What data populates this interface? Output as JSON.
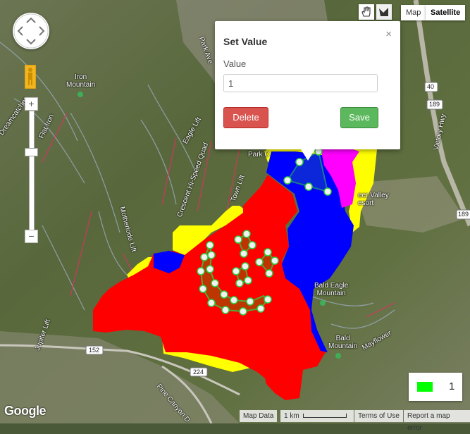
{
  "map": {
    "labels": {
      "iron_mountain": "Iron\nMountain",
      "park_ave": "Park Ave",
      "eagle_lift": "Eagle Lift",
      "crescent_lift": "Crescent Hi-Speed Quad",
      "town_lift": "Town Lift",
      "motherlode_lift": "Motherlode Lift",
      "jupiter_lift": "Jupiter Lift",
      "bald_eagle_mountain": "Bald Eagle\nMountain",
      "bald_mountain": "Bald\nMountain",
      "mayflower": "Mayflower",
      "victory_hwy": "Victory Hwy",
      "deer_valley": "eer Valley\nesort",
      "pine_canyon": "Pine Canyon D",
      "flat_iron": "Flat Iron",
      "dreamcatcher": "Dreamcatcher",
      "park_city": "Park C",
      "road_152": "152",
      "road_224": "224",
      "road_40": "40",
      "road_189_a": "189",
      "road_189_b": "189"
    },
    "region_colors": {
      "red": "#ff0000",
      "blue": "#0000ff",
      "yellow": "#ffff00",
      "magenta": "#ff00ff",
      "highlight": "#2ecc40"
    }
  },
  "controls": {
    "map_type_map": "Map",
    "map_type_satellite": "Satellite",
    "zoom_in": "+",
    "zoom_out": "−",
    "hand_tool_icon": "hand-icon",
    "polygon_tool_icon": "polygon-icon"
  },
  "popup": {
    "title": "Set Value",
    "close": "×",
    "value_label": "Value",
    "value": "1",
    "delete_label": "Delete",
    "save_label": "Save"
  },
  "legend": {
    "color": "#00ff00",
    "value": "1"
  },
  "footer": {
    "logo": "Google",
    "map_data": "Map Data",
    "scale": "1 km",
    "terms": "Terms of Use",
    "report": "Report a map error"
  }
}
